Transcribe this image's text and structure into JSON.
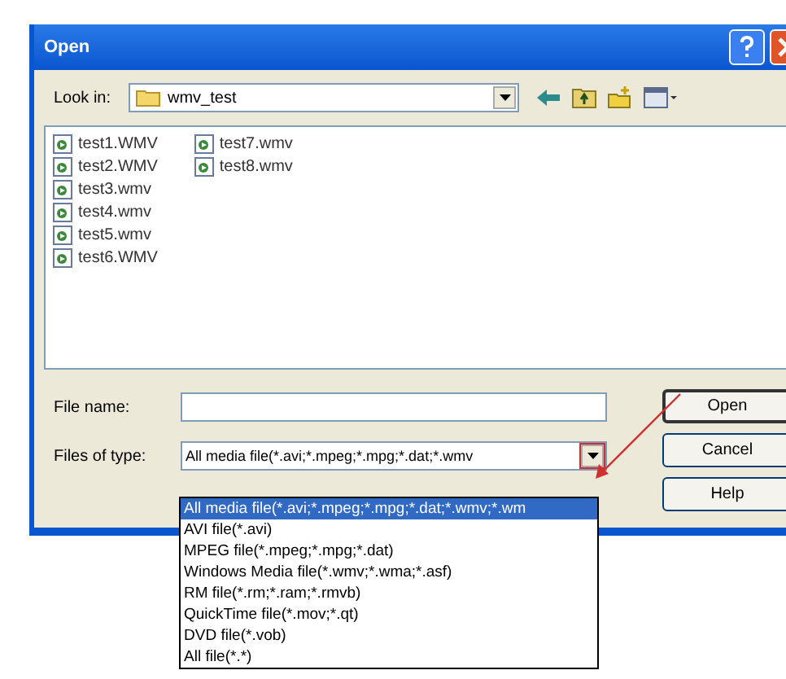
{
  "window": {
    "title": "Open"
  },
  "look_in": {
    "label": "Look in:",
    "value": "wmv_test"
  },
  "files": [
    {
      "name": "test1.WMV"
    },
    {
      "name": "test2.WMV"
    },
    {
      "name": "test3.wmv"
    },
    {
      "name": "test4.wmv"
    },
    {
      "name": "test5.wmv"
    },
    {
      "name": "test6.WMV"
    },
    {
      "name": "test7.wmv"
    },
    {
      "name": "test8.wmv"
    }
  ],
  "file_name": {
    "label": "File name:"
  },
  "files_of_type": {
    "label": "Files of type:",
    "value": "All media file(*.avi;*.mpeg;*.mpg;*.dat;*.wmv"
  },
  "buttons": [
    {
      "label": "Open",
      "default": true
    },
    {
      "label": "Cancel",
      "default": false
    },
    {
      "label": "Help",
      "default": false
    }
  ],
  "type_options": [
    {
      "label": "All media file(*.avi;*.mpeg;*.mpg;*.dat;*.wmv;*.wm",
      "selected": true
    },
    {
      "label": "AVI file(*.avi)",
      "selected": false
    },
    {
      "label": "MPEG file(*.mpeg;*.mpg;*.dat)",
      "selected": false
    },
    {
      "label": "Windows Media file(*.wmv;*.wma;*.asf)",
      "selected": false
    },
    {
      "label": "RM file(*.rm;*.ram;*.rmvb)",
      "selected": false
    },
    {
      "label": "QuickTime file(*.mov;*.qt)",
      "selected": false
    },
    {
      "label": "DVD file(*.vob)",
      "selected": false
    },
    {
      "label": "All file(*.*)",
      "selected": false
    }
  ]
}
